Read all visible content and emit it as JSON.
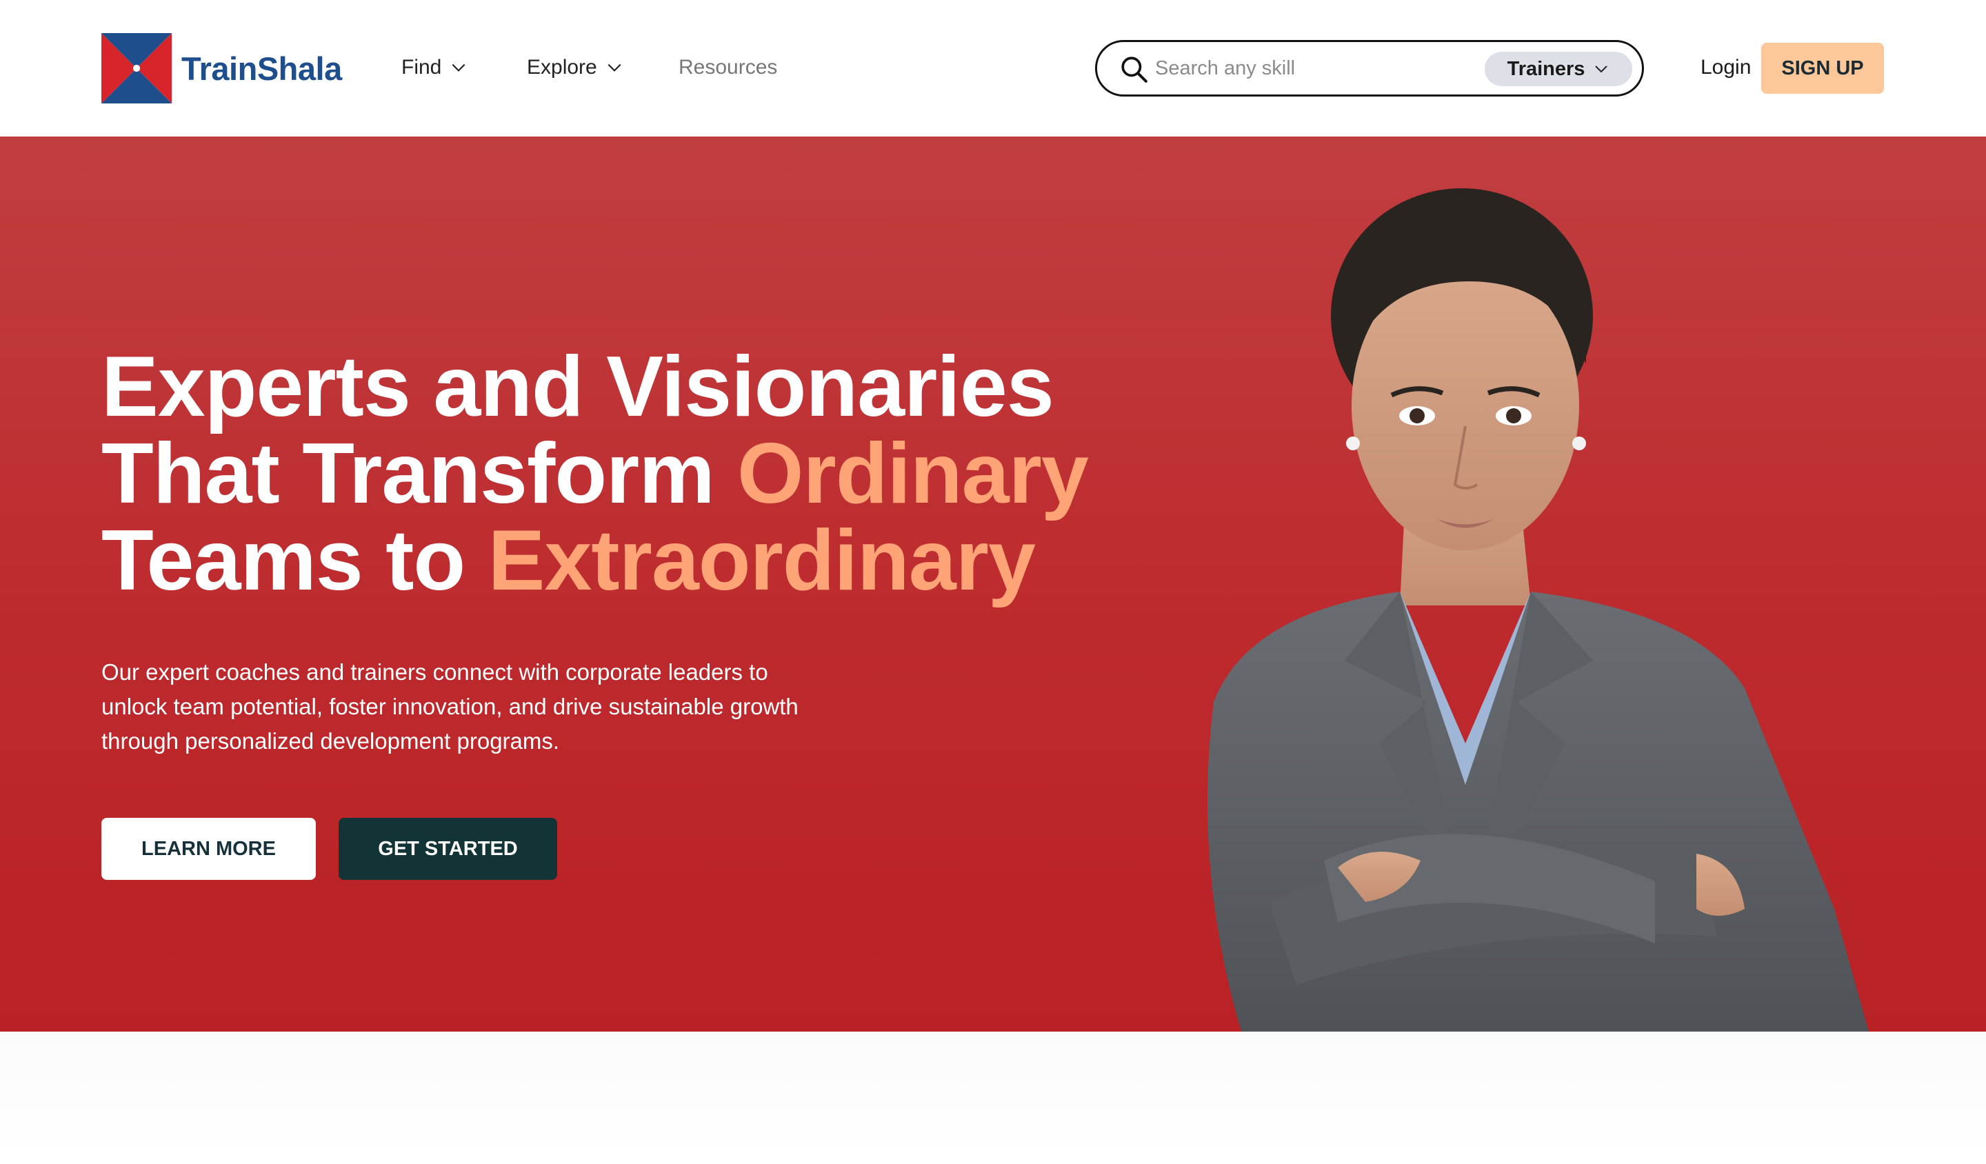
{
  "brand": {
    "name": "TrainShala",
    "colors": {
      "blue": "#1f4e8c",
      "red": "#d7252b",
      "accent": "#ffa476",
      "hero_bg": "#bd2a2d"
    }
  },
  "nav": {
    "find": "Find",
    "explore": "Explore",
    "resources": "Resources"
  },
  "search": {
    "placeholder": "Search any skill",
    "type_selected": "Trainers",
    "icon": "search-icon"
  },
  "auth": {
    "login": "Login",
    "signup": "SIGN UP"
  },
  "hero": {
    "headline_line1": "Experts and Visionaries",
    "headline_line2_pre": "That Transform ",
    "headline_line2_accent": "Ordinary",
    "headline_line3_pre": "Teams to ",
    "headline_line3_accent": "Extraordinary",
    "subtext": "Our expert coaches and trainers connect with corporate leaders to unlock team potential, foster innovation, and drive sustainable growth through personalized development programs.",
    "learn_more": "LEARN MORE",
    "get_started": "GET STARTED"
  }
}
